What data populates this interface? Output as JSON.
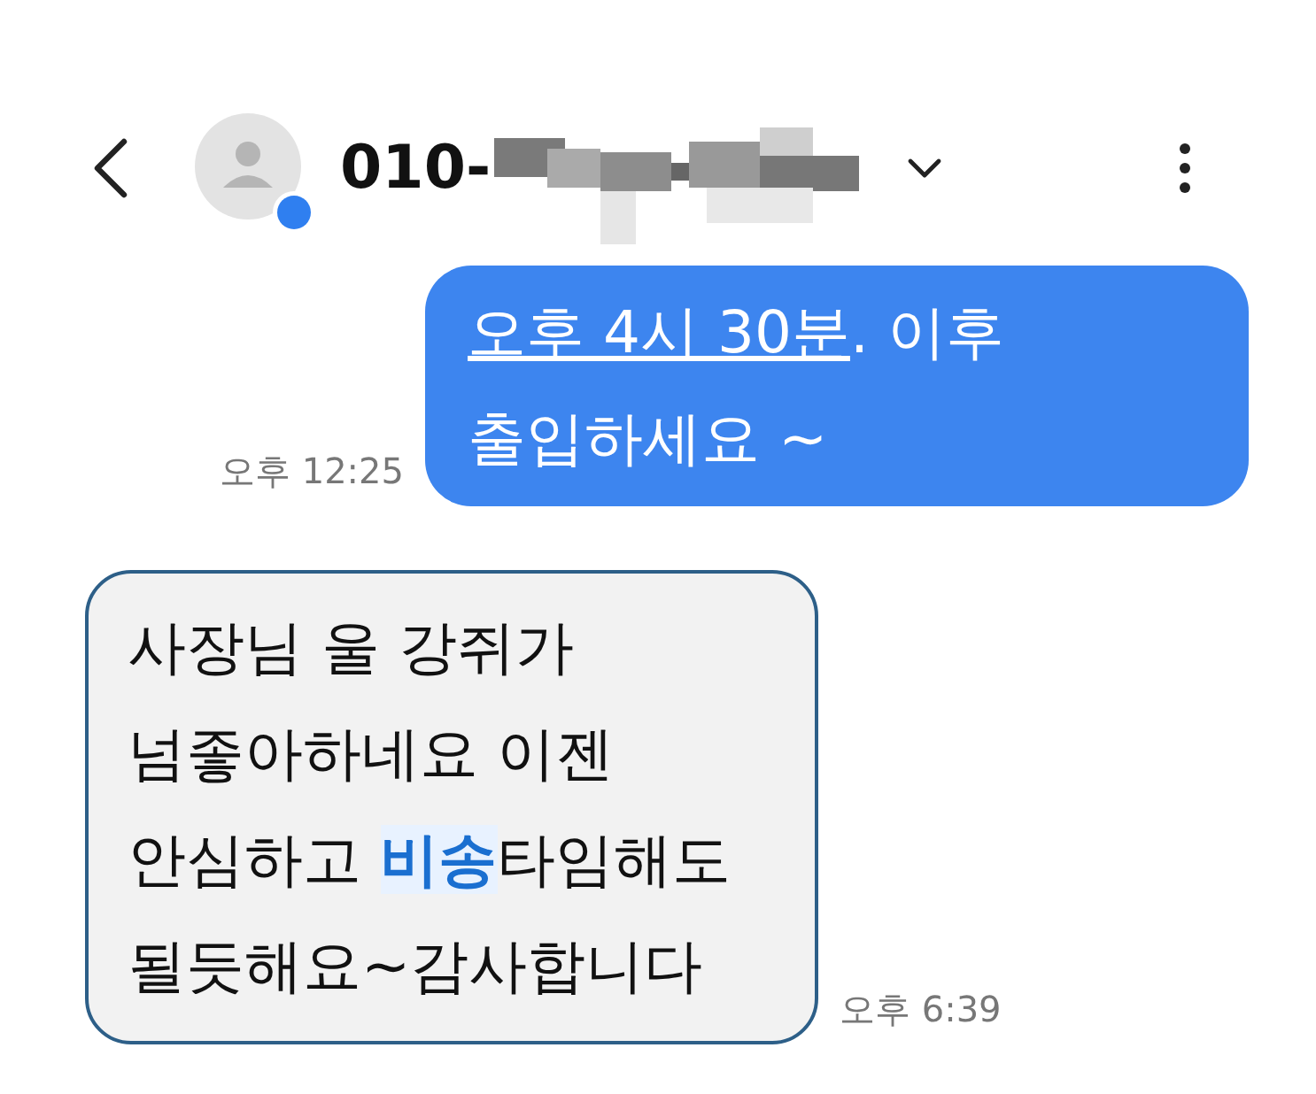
{
  "header": {
    "number_prefix": "010-",
    "number_redacted": true
  },
  "messages": [
    {
      "kind": "outgoing",
      "time": "오후 12:25",
      "parts": [
        {
          "kind": "link",
          "text": "오후 4시 30분"
        },
        {
          "kind": "text",
          "text": ". 이후\n출입하세요 ~"
        }
      ]
    },
    {
      "kind": "incoming",
      "time": "오후 6:39",
      "parts": [
        {
          "kind": "text",
          "text": "사장님 울 강쥐가\n넘좋아하네요 이젠\n안심하고 "
        },
        {
          "kind": "highlight",
          "text": "비송"
        },
        {
          "kind": "text",
          "text": "타임해도\n될듯해요~감사합니다"
        }
      ]
    }
  ]
}
